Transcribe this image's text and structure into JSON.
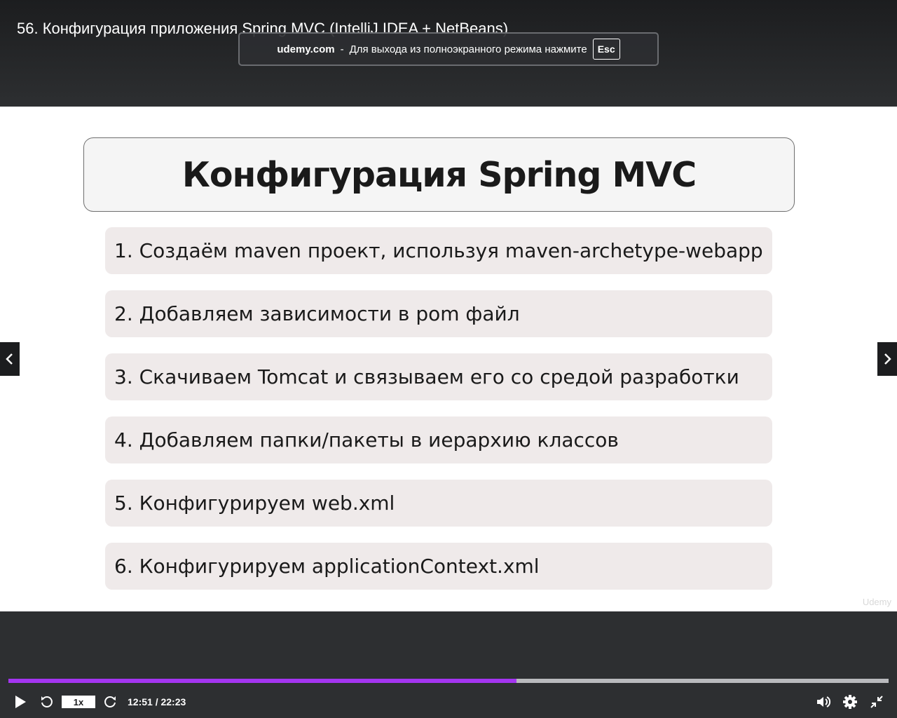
{
  "video": {
    "title": "56. Конфигурация приложения Spring MVC (IntelliJ IDEA + NetBeans)"
  },
  "fullscreen_notice": {
    "domain": "udemy.com",
    "separator": "-",
    "message": "Для выхода из полноэкранного режима нажмите",
    "key": "Esc"
  },
  "slide": {
    "title": "Конфигурация Spring MVC",
    "steps": [
      "1. Создаём maven проект, используя maven-archetype-webapp",
      "2. Добавляем зависимости в pom файл",
      "3. Скачиваем Tomcat и связываем его со средой разработки",
      "4. Добавляем папки/пакеты в иерархию классов",
      "5. Конфигурируем web.xml",
      "6. Конфигурируем applicationContext.xml"
    ],
    "watermark": "Udemy"
  },
  "player": {
    "progress_fraction": 0.5769,
    "speed": "1x",
    "time": "12:51 / 22:23",
    "icons": {
      "play": "play-icon",
      "rewind": "rewind-5-icon",
      "forward": "forward-5-icon",
      "volume": "volume-icon",
      "settings": "gear-icon",
      "exit_fullscreen": "exit-fullscreen-icon",
      "prev": "chevron-left-icon",
      "next": "chevron-right-icon"
    },
    "colors": {
      "progress_fill": "#a435f0",
      "progress_track": "#b9babd",
      "background": "#2d2f31"
    }
  }
}
